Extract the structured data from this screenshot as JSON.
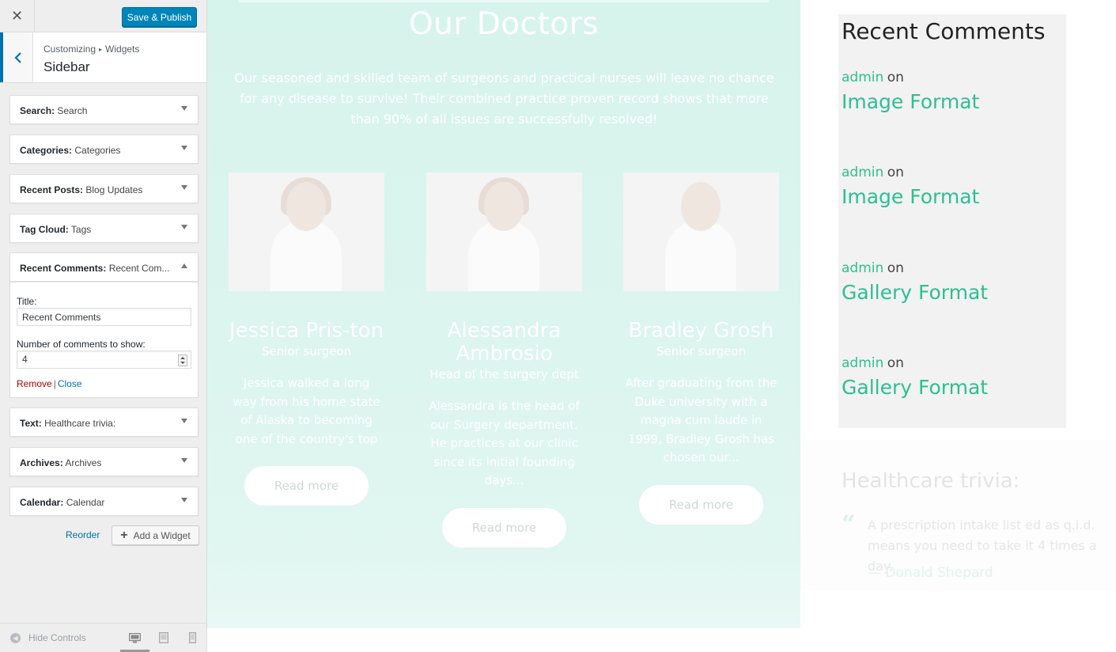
{
  "panel": {
    "close_symbol": "✕",
    "save_label": "Save & Publish",
    "breadcrumb": {
      "root": "Customizing",
      "sep": "▸",
      "current": "Widgets"
    },
    "section_name": "Sidebar",
    "widgets": [
      {
        "type": "Search",
        "instance": "Search"
      },
      {
        "type": "Categories",
        "instance": "Categories"
      },
      {
        "type": "Recent Posts",
        "instance": "Blog Updates"
      },
      {
        "type": "Tag Cloud",
        "instance": "Tags"
      },
      {
        "type": "Recent Comments",
        "instance": "Recent Com..."
      },
      {
        "type": "Text",
        "instance": "Healthcare trivia:"
      },
      {
        "type": "Archives",
        "instance": "Archives"
      },
      {
        "type": "Calendar",
        "instance": "Calendar"
      }
    ],
    "expanded": {
      "title_label": "Title:",
      "title_value": "Recent Comments",
      "count_label": "Number of comments to show:",
      "count_value": "4",
      "remove_label": "Remove",
      "separator": "|",
      "close_label": "Close"
    },
    "reorder_label": "Reorder",
    "add_widget_label": "Add a Widget",
    "hide_controls_label": "Hide Controls",
    "colors": {
      "primary": "#0085ba",
      "link": "#0073aa",
      "remove": "#aa0000"
    }
  },
  "preview": {
    "doctors": {
      "title": "Our Doctors",
      "intro": "Our seasoned and skilled team of surgeons and practical nurses will leave no chance for any disease to survive! Their combined practice proven record shows that more than 90% of all issues are successfully resolved!",
      "cards": [
        {
          "name": "Jessica Pris-ton",
          "role": "Senior surgeon",
          "bio": "Jessica walked a long way from his home state of Alaska to becoming one of the country's top",
          "button": "Read more"
        },
        {
          "name": "Alessandra Ambrosio",
          "role": "Head of the surgery dept",
          "bio": "Alessandra is the head of our Surgery department. He practices at our clinic since its initial founding days...",
          "button": "Read more"
        },
        {
          "name": "Bradley Grosh",
          "role": "Senior surgeon",
          "bio": "After graduating from the Duke university with a magna cum laude in 1999, Bradley Grosh has chosen our...",
          "button": "Read more"
        }
      ]
    },
    "recent_comments": {
      "title": "Recent Comments",
      "items": [
        {
          "author": "admin",
          "on": "on",
          "post": "Image Format"
        },
        {
          "author": "admin",
          "on": "on",
          "post": "Image Format"
        },
        {
          "author": "admin",
          "on": "on",
          "post": "Gallery Format"
        },
        {
          "author": "admin",
          "on": "on",
          "post": "Gallery Format"
        }
      ]
    },
    "trivia": {
      "title": "Healthcare trivia:",
      "quote": "A prescription intake list ed as q.i.d. means you need to take it 4 times a day.",
      "author": "— Donald Shepard"
    },
    "colors": {
      "accent": "#2ebf91",
      "section_bg": "#d6f3ec"
    }
  }
}
